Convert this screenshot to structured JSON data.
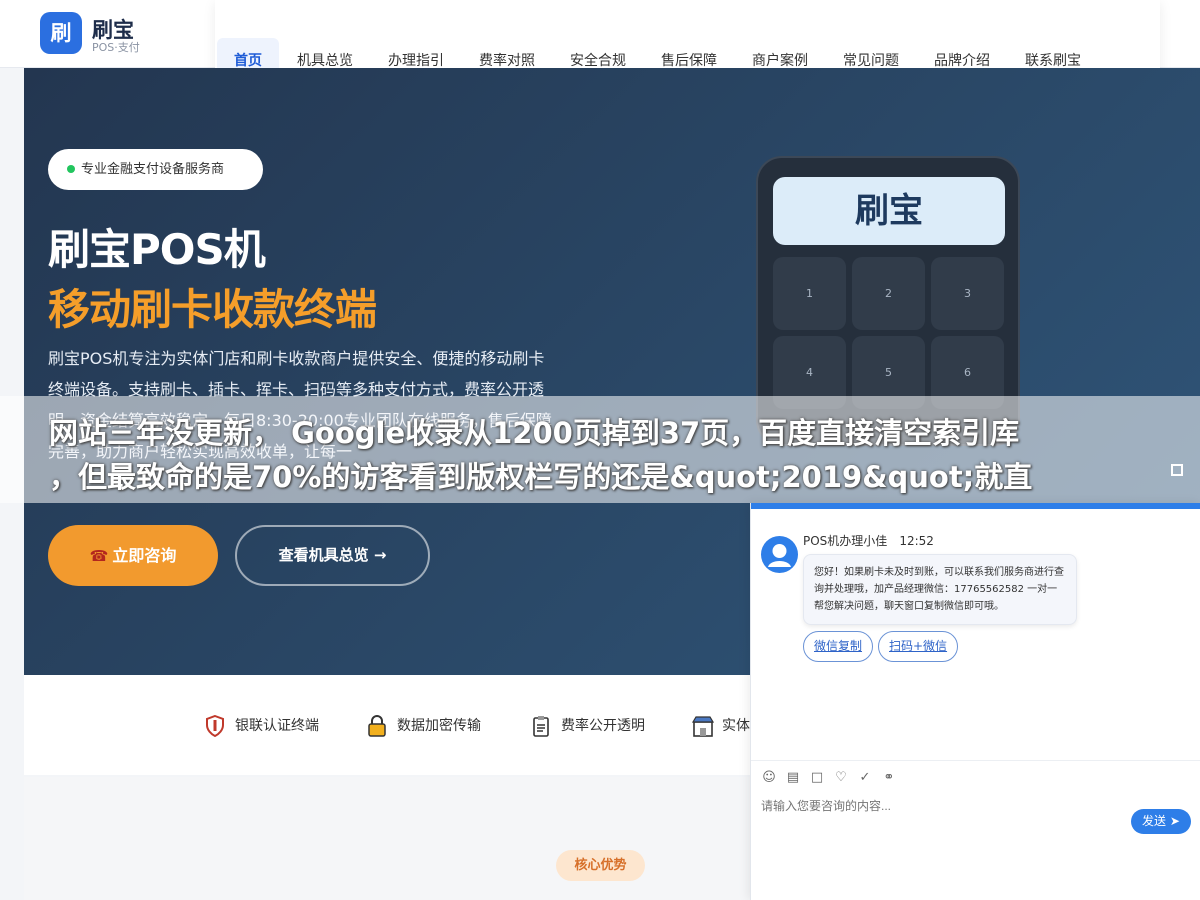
{
  "header": {
    "logo_char": "刷",
    "brand": "刷宝",
    "brand_sub": "POS·支付",
    "nav": [
      "首页",
      "机具总览",
      "办理指引",
      "费率对照",
      "安全合规",
      "售后保障",
      "商户案例",
      "常见问题",
      "品牌介绍",
      "联系刷宝"
    ]
  },
  "hero": {
    "badge": "专业金融支付设备服务商",
    "title_line1": "刷宝POS机",
    "title_line2": "移动刷卡收款终端",
    "description": "刷宝POS机专注为实体门店和刷卡收款商户提供安全、便捷的移动刷卡终端设备。支持刷卡、插卡、挥卡、扫码等多种支付方式，费率公开透明，资金结算高效稳定，每日8:30-20:00专业团队在线服务，售后保障完善，助力商户轻松实现高效收单，让每一",
    "primary_button": "立即咨询",
    "secondary_button": "查看机具总览 →",
    "device_screen": "刷宝",
    "keys": [
      "1",
      "2",
      "3",
      "4",
      "5",
      "6"
    ]
  },
  "overlay": {
    "line1": "网站三年没更新，  Google收录从1200页掉到37页，百度直接清空索引库",
    "line2": "，但最致命的是70%的访客看到版权栏写的还是&quot;2019&quot;就直"
  },
  "features": [
    {
      "icon": "shield-icon",
      "label": "银联认证终端"
    },
    {
      "icon": "lock-icon",
      "label": "数据加密传输"
    },
    {
      "icon": "clipboard-icon",
      "label": "费率公开透明"
    },
    {
      "icon": "store-icon",
      "label": "实体"
    }
  ],
  "section_badge": "核心优势",
  "chat": {
    "agent_name": "POS机办理小佳",
    "time": "12:52",
    "message": "您好！如果刷卡未及时到账，可以联系我们服务商进行查询并处理哦，加产品经理微信：17765562582 一对一帮您解决问题，聊天窗口复制微信即可哦。",
    "quick_buttons": [
      "微信复制",
      "扫码+微信"
    ],
    "input_placeholder": "请输入您要咨询的内容...",
    "send_label": "发送",
    "tools": [
      "emoji-icon",
      "image-icon",
      "screenshot-icon",
      "rate-icon",
      "like-icon",
      "switch-icon"
    ]
  },
  "colors": {
    "brand_blue": "#2b6fe0",
    "accent_orange": "#f29a2e",
    "hero_bg": "#2a4867"
  }
}
